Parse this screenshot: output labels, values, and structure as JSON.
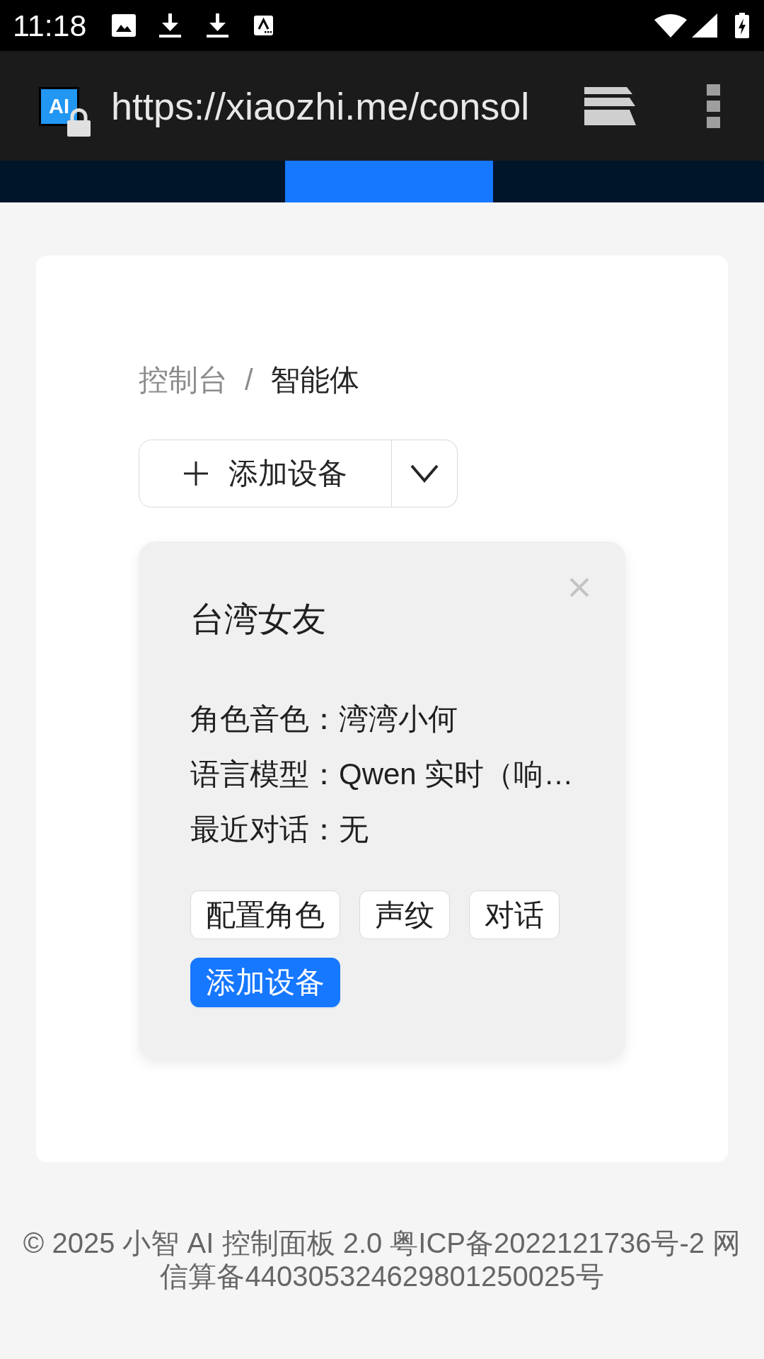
{
  "status_bar": {
    "time": "11:18"
  },
  "browser": {
    "site_icon_text": "AI",
    "url": "https://xiaozhi.me/consol"
  },
  "nav_bar": {
    "items": [
      {
        "selected": false
      },
      {
        "selected": true
      },
      {
        "selected": false
      }
    ]
  },
  "breadcrumb": {
    "items": [
      {
        "label": "控制台",
        "current": false
      },
      {
        "label": "智能体",
        "current": true
      }
    ],
    "separator": "/"
  },
  "add_device_button": {
    "label": "添加设备"
  },
  "agent_card": {
    "title": "台湾女友",
    "fields": [
      {
        "label": "角色音色：",
        "value": "湾湾小何"
      },
      {
        "label": "语言模型：",
        "value": "Qwen 实时（响…"
      },
      {
        "label": "最近对话：",
        "value": "无"
      }
    ],
    "actions": [
      {
        "label": "配置角色",
        "kind": "default"
      },
      {
        "label": "声纹",
        "kind": "default"
      },
      {
        "label": "对话",
        "kind": "default"
      },
      {
        "label": "添加设备",
        "kind": "primary"
      }
    ]
  },
  "footer": {
    "text": "© 2025 小智 AI 控制面板 2.0 粤ICP备2022121736号-2 网信算备440305324629801250025号"
  }
}
